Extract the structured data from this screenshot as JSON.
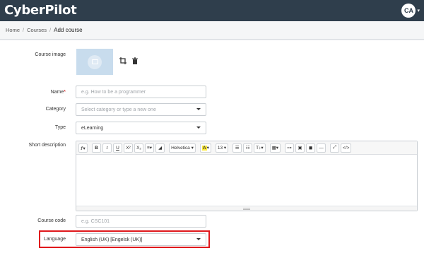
{
  "app": {
    "logo_text": "CyberPilot"
  },
  "user": {
    "initials": "CA",
    "caret": "▾"
  },
  "breadcrumb": {
    "items": [
      "Home",
      "Courses"
    ],
    "separator": "/",
    "current": "Add course"
  },
  "form": {
    "course_image": {
      "label": "Course image"
    },
    "name": {
      "label": "Name",
      "required_mark": "*",
      "placeholder": "e.g. How to be a programmer"
    },
    "category": {
      "label": "Category",
      "placeholder": "Select category or type a new one"
    },
    "type": {
      "label": "Type",
      "value": "eLearning"
    },
    "short_description": {
      "label": "Short description",
      "toolbar": {
        "style": "Ꝭ▾",
        "bold": "B",
        "italic": "I",
        "underline": "U",
        "superscript": "X²",
        "subscript": "X₂",
        "align": "≡▾",
        "clear": "◢",
        "font": "Helvetica ▾",
        "color_a": "A",
        "color_caret": "▾",
        "size": "13 ▾",
        "ul": "☰",
        "ol": "☷",
        "textsize": "T↕▾",
        "table": "▦▾",
        "link": "⊶",
        "image": "▣",
        "video": "◼",
        "hr": "—",
        "fullscreen": "⤢",
        "code": "</>"
      }
    },
    "course_code": {
      "label": "Course code",
      "placeholder": "e.g. CSC101"
    },
    "language": {
      "label": "Language",
      "value": "English (UK) [Engelsk (UK)]"
    }
  },
  "colors": {
    "topbar": "#2f3e4c",
    "highlight": "#e0181c",
    "image_placeholder": "#c8dced"
  }
}
